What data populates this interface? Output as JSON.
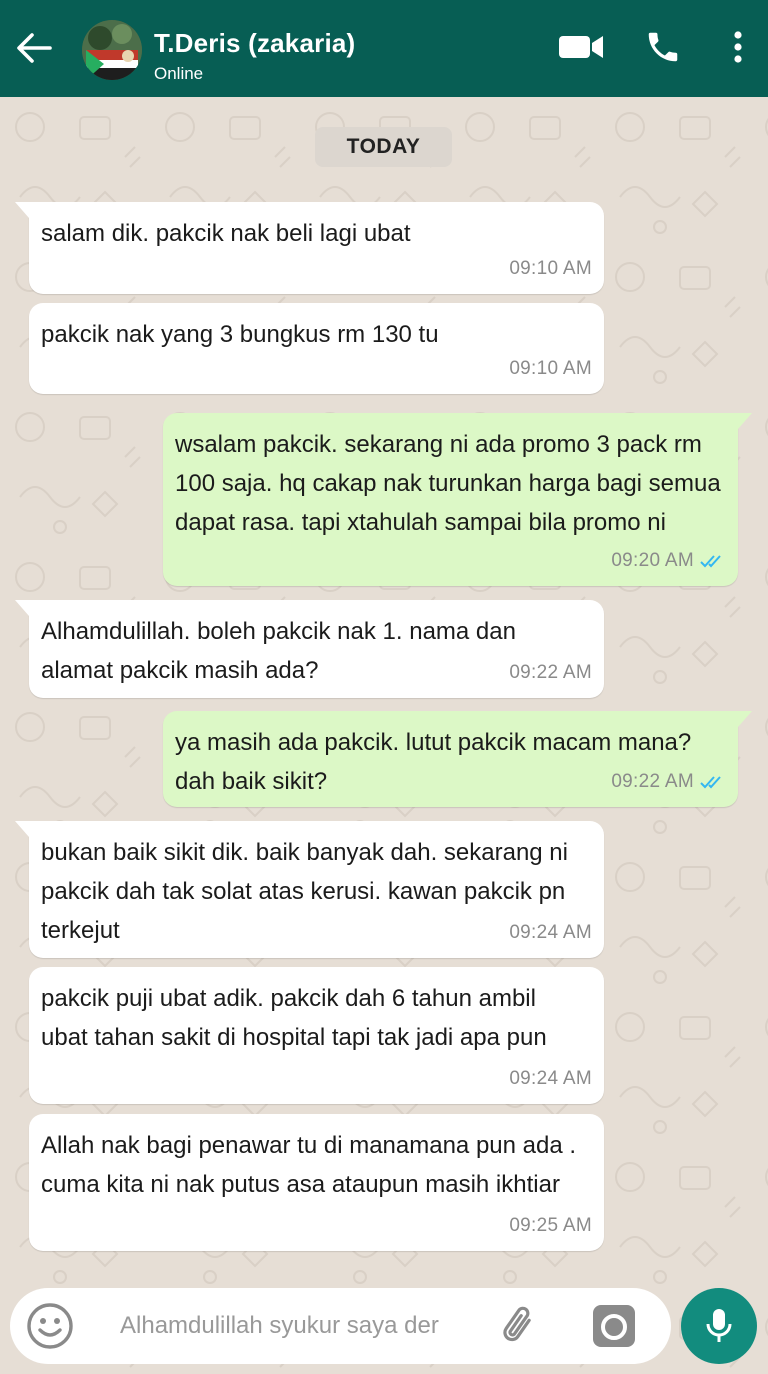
{
  "header": {
    "contact_name": "T.Deris (zakaria)",
    "status": "Online",
    "color": "#075e54"
  },
  "chat": {
    "date_chip": "TODAY",
    "wallpaper_color": "#e6ded5",
    "messages": [
      {
        "direction": "in",
        "text": "salam dik. pakcik nak beli lagi ubat",
        "time": "09:10 AM"
      },
      {
        "direction": "in",
        "text": "pakcik nak yang 3 bungkus rm 130 tu",
        "time": "09:10 AM"
      },
      {
        "direction": "out",
        "text": "wsalam pakcik. sekarang ni ada promo 3 pack rm 100 saja. hq cakap nak turunkan harga bagi semua dapat rasa. tapi xtahulah sampai bila promo ni",
        "time": "09:20 AM",
        "status": "read"
      },
      {
        "direction": "in",
        "text": "Alhamdulillah. boleh pakcik nak 1. nama dan alamat pakcik masih ada?",
        "time": "09:22 AM"
      },
      {
        "direction": "out",
        "text": "ya masih ada pakcik. lutut pakcik macam mana? dah baik sikit?",
        "time": "09:22 AM",
        "status": "read"
      },
      {
        "direction": "in",
        "text": "bukan baik sikit dik. baik banyak dah. sekarang ni pakcik dah tak solat atas kerusi. kawan pakcik pn terkejut",
        "time": "09:24 AM"
      },
      {
        "direction": "in",
        "text": "pakcik puji ubat adik. pakcik dah 6 tahun ambil ubat tahan sakit di hospital tapi tak jadi apa pun",
        "time": "09:24 AM"
      },
      {
        "direction": "in",
        "text": "Allah nak bagi penawar tu di manamana pun ada . cuma kita ni nak putus asa ataupun masih ikhtiar",
        "time": "09:25 AM"
      }
    ]
  },
  "composer": {
    "value": "Alhamdulillah syukur saya der",
    "mic_color": "#128c7e",
    "icons": [
      "emoji-icon",
      "paperclip-icon",
      "camera-icon",
      "mic-icon"
    ]
  },
  "colors": {
    "incoming_bubble": "#ffffff",
    "outgoing_bubble": "#dcf8c6",
    "read_ticks": "#34b7f1"
  }
}
